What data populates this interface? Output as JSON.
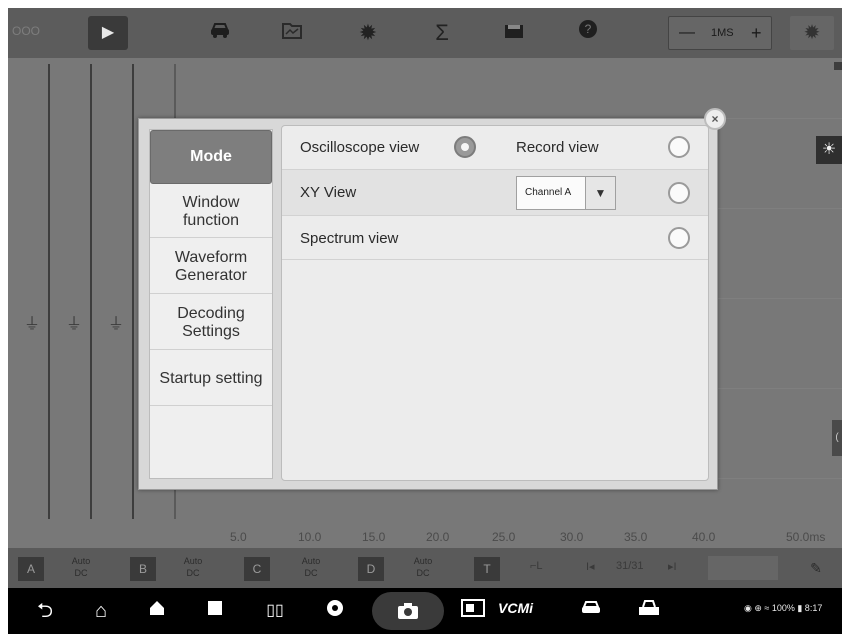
{
  "topbar": {
    "logo_text": "OOO",
    "zoom_minus": "—",
    "zoom_value": "1MS",
    "zoom_plus": "+"
  },
  "icons": {
    "play": "▶",
    "car": "car-icon",
    "folder": "folder-icon",
    "settings": "gear-icon",
    "sigma": "Σ",
    "save": "save-icon",
    "help": "help-icon",
    "gear2": "gear-icon"
  },
  "scope": {
    "x_ticks": [
      "5.0",
      "10.0",
      "15.0",
      "20.0",
      "25.0",
      "30.0",
      "35.0",
      "40.0",
      "50.0ms"
    ],
    "channel_columns": [
      "A",
      "B",
      "C"
    ]
  },
  "channels": [
    {
      "id": "A",
      "mode_line1": "Auto",
      "mode_line2": "DC"
    },
    {
      "id": "B",
      "mode_line1": "Auto",
      "mode_line2": "DC"
    },
    {
      "id": "C",
      "mode_line1": "Auto",
      "mode_line2": "DC"
    },
    {
      "id": "D",
      "mode_line1": "Auto",
      "mode_line2": "DC"
    }
  ],
  "chanbar": {
    "trigger": "T",
    "edge": "⌐L",
    "first": "I◂",
    "page": "31/31",
    "next": "▸I"
  },
  "navbar": {
    "vcmi": "VCMi",
    "status": "◉ ⊕ ≈ 100% ▮ 8:17"
  },
  "dialog": {
    "close": "×",
    "menu": [
      {
        "label": "Mode",
        "active": true
      },
      {
        "label": "Window\nfunction",
        "active": false
      },
      {
        "label": "Waveform\nGenerator",
        "active": false
      },
      {
        "label": "Decoding\nSettings",
        "active": false
      },
      {
        "label": "Startup setting",
        "active": false
      }
    ],
    "options": {
      "oscilloscope": "Oscilloscope view",
      "record": "Record view",
      "xy": "XY View",
      "spectrum": "Spectrum view",
      "xy_channel": "Channel A"
    },
    "selected": "oscilloscope"
  }
}
